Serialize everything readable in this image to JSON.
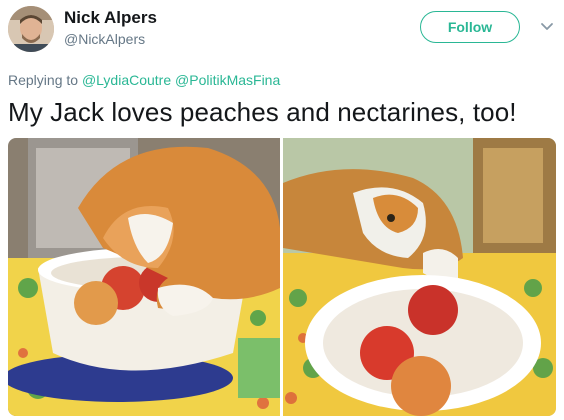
{
  "author": {
    "name": "Nick Alpers",
    "handle": "@NickAlpers",
    "avatar_icon": "user-avatar"
  },
  "actions": {
    "follow_label": "Follow",
    "more_icon": "chevron-down-icon"
  },
  "reply": {
    "prefix": "Replying to",
    "mentions": [
      "@LydiaCoutre",
      "@PolitikMasFina"
    ]
  },
  "tweet": {
    "text": "My Jack loves peaches and nectarines, too!"
  },
  "media": {
    "photos": [
      {
        "name": "cat-reaching-into-bowl-photo"
      },
      {
        "name": "cat-with-peaches-bowl-photo"
      }
    ]
  },
  "colors": {
    "accent": "#2ab795",
    "text": "#14171a",
    "muted": "#657786"
  }
}
